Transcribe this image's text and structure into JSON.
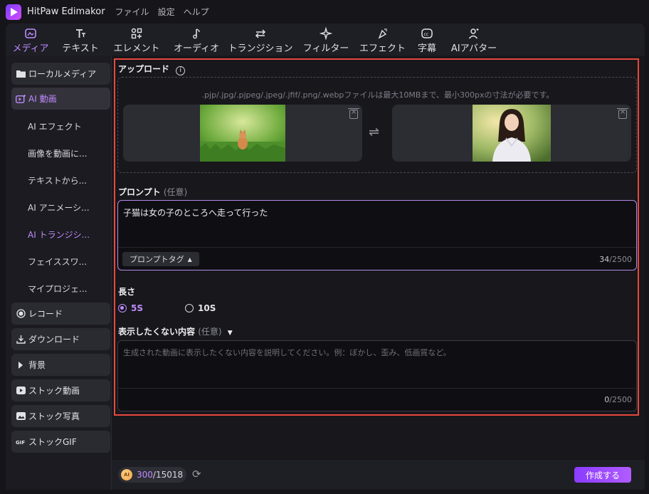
{
  "app": {
    "name": "HitPaw Edimakor"
  },
  "menubar": [
    "ファイル",
    "設定",
    "ヘルプ"
  ],
  "toolbar": [
    {
      "label": "メディア",
      "icon": "media-icon",
      "active": true
    },
    {
      "label": "テキスト",
      "icon": "text-icon"
    },
    {
      "label": "エレメント",
      "icon": "elements-icon"
    },
    {
      "label": "オーディオ",
      "icon": "audio-icon"
    },
    {
      "label": "トランジション",
      "icon": "transition-icon"
    },
    {
      "label": "フィルター",
      "icon": "filter-icon"
    },
    {
      "label": "エフェクト",
      "icon": "effect-icon"
    },
    {
      "label": "字幕",
      "icon": "caption-icon"
    },
    {
      "label": "AIアバター",
      "icon": "avatar-icon"
    }
  ],
  "sidebar": {
    "buttons": {
      "local_media": "ローカルメディア",
      "ai_video": "AI 動画",
      "record": "レコード",
      "download": "ダウンロード",
      "background": "背景",
      "stock_video": "ストック動画",
      "stock_photo": "ストック写真",
      "stock_gif": "ストックGIF"
    },
    "sub": {
      "ai_effect": "AI エフェクト",
      "image_to_video": "画像を動画に...",
      "text_to": "テキストから...",
      "ai_animation": "AI アニメーシ...",
      "ai_transition": "AI トランジシ...",
      "face_swap": "フェイススワ...",
      "my_project": "マイプロジェ..."
    }
  },
  "upload": {
    "title": "アップロード",
    "hint": ".pjp/.jpg/.pjpeg/.jpeg/.jfif/.png/.webpファイルは最大10MBまで、最小300pxの寸法が必要です。"
  },
  "prompt": {
    "title": "プロンプト",
    "optional": "(任意)",
    "value": "子猫は女の子のところへ走って行った",
    "tag_button": "プロンプトタグ",
    "count": "34",
    "max": "/2500"
  },
  "length": {
    "title": "長さ",
    "options": [
      "5S",
      "10S"
    ],
    "selected": "5S"
  },
  "negative": {
    "title": "表示したくない内容",
    "optional": "(任意)",
    "placeholder": "生成された動画に表示したくない内容を説明してください。例：ぼかし、歪み、低画質など。",
    "count": "0",
    "max": "/2500"
  },
  "footer": {
    "coin_label": "AI",
    "credits_used": "300",
    "credits_total": "/15018",
    "create_button": "作成する"
  },
  "colors": {
    "accent": "#c08cff",
    "highlight": "#e8473c"
  }
}
